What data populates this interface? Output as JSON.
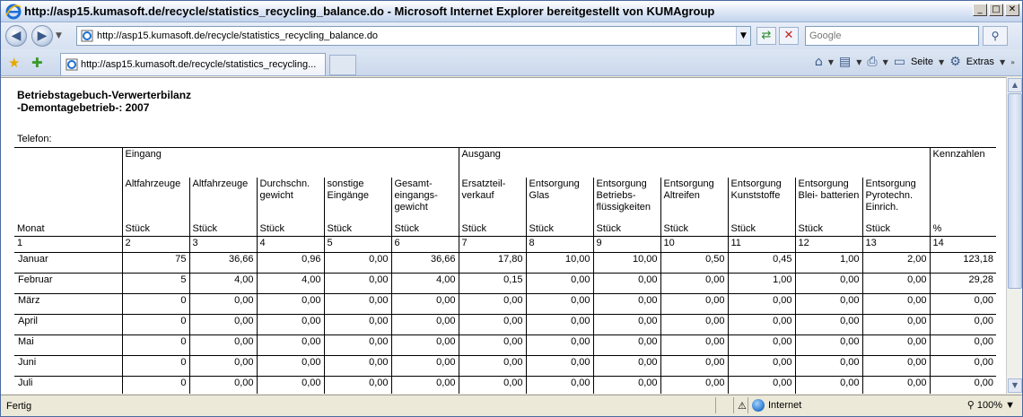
{
  "window": {
    "title": "http://asp15.kumasoft.de/recycle/statistics_recycling_balance.do - Microsoft Internet Explorer bereitgestellt von KUMAgroup",
    "controls": [
      "_",
      "□",
      "✕"
    ]
  },
  "navbar": {
    "url": "http://asp15.kumasoft.de/recycle/statistics_recycling_balance.do",
    "search_placeholder": "Google"
  },
  "tabbar": {
    "tab_title": "http://asp15.kumasoft.de/recycle/statistics_recycling...",
    "seite_label": "Seite",
    "extras_label": "Extras"
  },
  "report": {
    "title_line1": "Betriebstagebuch-Verwerterbilanz",
    "title_line2": "-Demontagebetrieb-: 2007",
    "telefon": "Telefon:",
    "group_eingang": "Eingang",
    "group_ausgang": "Ausgang",
    "group_kennzahlen": "Kennzahlen",
    "monat_label": "Monat",
    "columns": [
      "Altfahrzeuge",
      "Altfahrzeuge",
      "Durchschn. gewicht",
      "sonstige Eingänge",
      "Gesamt- eingangs- gewicht",
      "Ersatzteil- verkauf",
      "Entsorgung Glas",
      "Entsorgung Betriebs- flüssigkeiten",
      "Entsorgung Altreifen",
      "Entsorgung Kunststoffe",
      "Entsorgung Blei- batterien",
      "Entsorgung Pyrotechn. Einrich.",
      ""
    ],
    "units": [
      "Stück",
      "Stück",
      "Stück",
      "Stück",
      "Stück",
      "Stück",
      "Stück",
      "Stück",
      "Stück",
      "Stück",
      "Stück",
      "Stück",
      "%"
    ],
    "numbers": [
      "1",
      "2",
      "3",
      "4",
      "5",
      "6",
      "7",
      "8",
      "9",
      "10",
      "11",
      "12",
      "13",
      "14"
    ],
    "rows": [
      {
        "month": "Januar",
        "values": [
          "75",
          "36,66",
          "0,96",
          "0,00",
          "36,66",
          "17,80",
          "10,00",
          "10,00",
          "0,50",
          "0,45",
          "1,00",
          "2,00",
          "123,18"
        ]
      },
      {
        "month": "Februar",
        "values": [
          "5",
          "4,00",
          "4,00",
          "0,00",
          "4,00",
          "0,15",
          "0,00",
          "0,00",
          "0,00",
          "1,00",
          "0,00",
          "0,00",
          "29,28"
        ]
      },
      {
        "month": "März",
        "values": [
          "0",
          "0,00",
          "0,00",
          "0,00",
          "0,00",
          "0,00",
          "0,00",
          "0,00",
          "0,00",
          "0,00",
          "0,00",
          "0,00",
          "0,00"
        ]
      },
      {
        "month": "April",
        "values": [
          "0",
          "0,00",
          "0,00",
          "0,00",
          "0,00",
          "0,00",
          "0,00",
          "0,00",
          "0,00",
          "0,00",
          "0,00",
          "0,00",
          "0,00"
        ]
      },
      {
        "month": "Mai",
        "values": [
          "0",
          "0,00",
          "0,00",
          "0,00",
          "0,00",
          "0,00",
          "0,00",
          "0,00",
          "0,00",
          "0,00",
          "0,00",
          "0,00",
          "0,00"
        ]
      },
      {
        "month": "Juni",
        "values": [
          "0",
          "0,00",
          "0,00",
          "0,00",
          "0,00",
          "0,00",
          "0,00",
          "0,00",
          "0,00",
          "0,00",
          "0,00",
          "0,00",
          "0,00"
        ]
      },
      {
        "month": "Juli",
        "values": [
          "0",
          "0,00",
          "0,00",
          "0,00",
          "0,00",
          "0,00",
          "0,00",
          "0,00",
          "0,00",
          "0,00",
          "0,00",
          "0,00",
          "0,00"
        ]
      }
    ]
  },
  "statusbar": {
    "status": "Fertig",
    "zone": "Internet",
    "zoom": "100%"
  }
}
